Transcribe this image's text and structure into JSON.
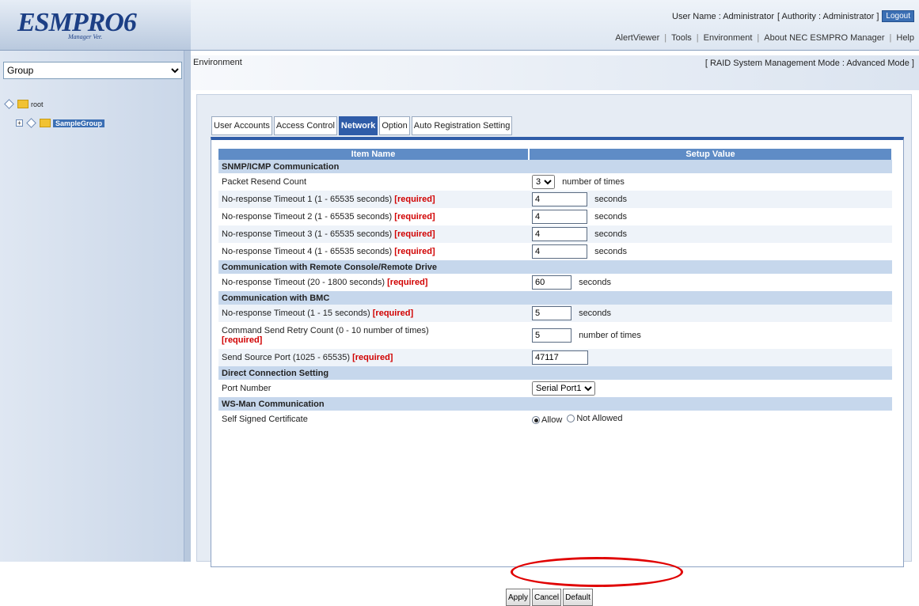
{
  "header": {
    "logo_main": "ESMPRO6",
    "logo_sub": "Manager Ver.",
    "user_name_label": "User Name : Administrator",
    "authority_label": "[ Authority : Administrator ]",
    "logout_label": "Logout",
    "menu": [
      "AlertViewer",
      "Tools",
      "Environment",
      "About NEC ESMPRO Manager",
      "Help"
    ]
  },
  "sidebar": {
    "group_select": {
      "selected": "Group",
      "options": [
        "Group"
      ]
    },
    "tree": {
      "root": "root",
      "child": "SampleGroup"
    }
  },
  "main": {
    "breadcrumb": "Environment",
    "mode_text": "[ RAID System Management Mode : Advanced Mode ]",
    "tabs": [
      {
        "label": "User Accounts",
        "active": false
      },
      {
        "label": "Access Control",
        "active": false
      },
      {
        "label": "Network",
        "active": true
      },
      {
        "label": "Option",
        "active": false
      },
      {
        "label": "Auto Registration Setting",
        "active": false
      }
    ],
    "table": {
      "col_item": "Item Name",
      "col_value": "Setup Value",
      "required": "[required]",
      "snmp": {
        "header": "SNMP/ICMP Communication",
        "resend_label": "Packet Resend Count",
        "resend_value": "3",
        "resend_unit": "number of times",
        "timeout1_label": "No-response Timeout 1  (1 - 65535 seconds)",
        "timeout1_value": "4",
        "timeout2_label": "No-response Timeout 2  (1 - 65535 seconds)",
        "timeout2_value": "4",
        "timeout3_label": "No-response Timeout 3  (1 - 65535 seconds)",
        "timeout3_value": "4",
        "timeout4_label": "No-response Timeout 4  (1 - 65535 seconds)",
        "timeout4_value": "4",
        "seconds": "seconds"
      },
      "remote": {
        "header": "Communication with Remote Console/Remote Drive",
        "timeout_label": "No-response Timeout  (20 - 1800 seconds)",
        "timeout_value": "60",
        "seconds": "seconds"
      },
      "bmc": {
        "header": "Communication with BMC",
        "timeout_label": "No-response Timeout  (1 - 15 seconds)",
        "timeout_value": "5",
        "seconds": "seconds",
        "retry_label": "Command Send Retry Count  (0 - 10 number of times)",
        "retry_value": "5",
        "retry_unit": "number of times",
        "port_label": "Send Source Port  (1025 - 65535)",
        "port_value": "47117"
      },
      "direct": {
        "header": "Direct Connection Setting",
        "port_label": "Port Number",
        "port_value": "Serial Port1"
      },
      "wsman": {
        "header": "WS-Man Communication",
        "cert_label": "Self Signed Certificate",
        "allow": "Allow",
        "not_allowed": "Not Allowed",
        "selected": "Allow"
      }
    },
    "buttons": {
      "apply": "Apply",
      "cancel": "Cancel",
      "default": "Default"
    }
  },
  "colors": {
    "accent": "#2f5ca8",
    "required": "#d10000",
    "highlight": "#e00000"
  }
}
